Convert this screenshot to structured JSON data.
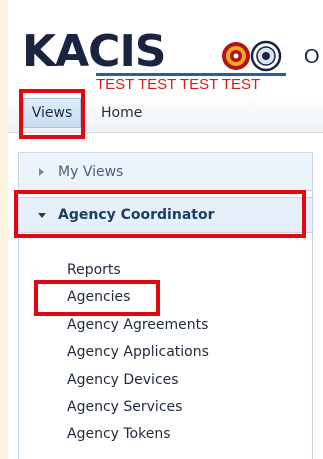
{
  "header": {
    "logo_text": "KACIS",
    "test_banner": "TEST TEST TEST TEST",
    "title_fragment": "O"
  },
  "nav": {
    "views_label": "Views",
    "home_label": "Home"
  },
  "sidebar": {
    "my_views_label": "My Views",
    "agency_coordinator_label": "Agency Coordinator",
    "items": [
      {
        "label": "Reports"
      },
      {
        "label": "Agencies"
      },
      {
        "label": "Agency Agreements"
      },
      {
        "label": "Agency Applications"
      },
      {
        "label": "Agency Devices"
      },
      {
        "label": "Agency Services"
      },
      {
        "label": "Agency Tokens"
      }
    ]
  },
  "colors": {
    "highlight": "#e30613",
    "brand_navy": "#1a2340",
    "test_red": "#d41b1b",
    "page_bg": "#fdf3df"
  },
  "icons": [
    "chevron-right-icon",
    "chevron-down-icon",
    "fire-badge-icon",
    "seal-badge-icon"
  ]
}
